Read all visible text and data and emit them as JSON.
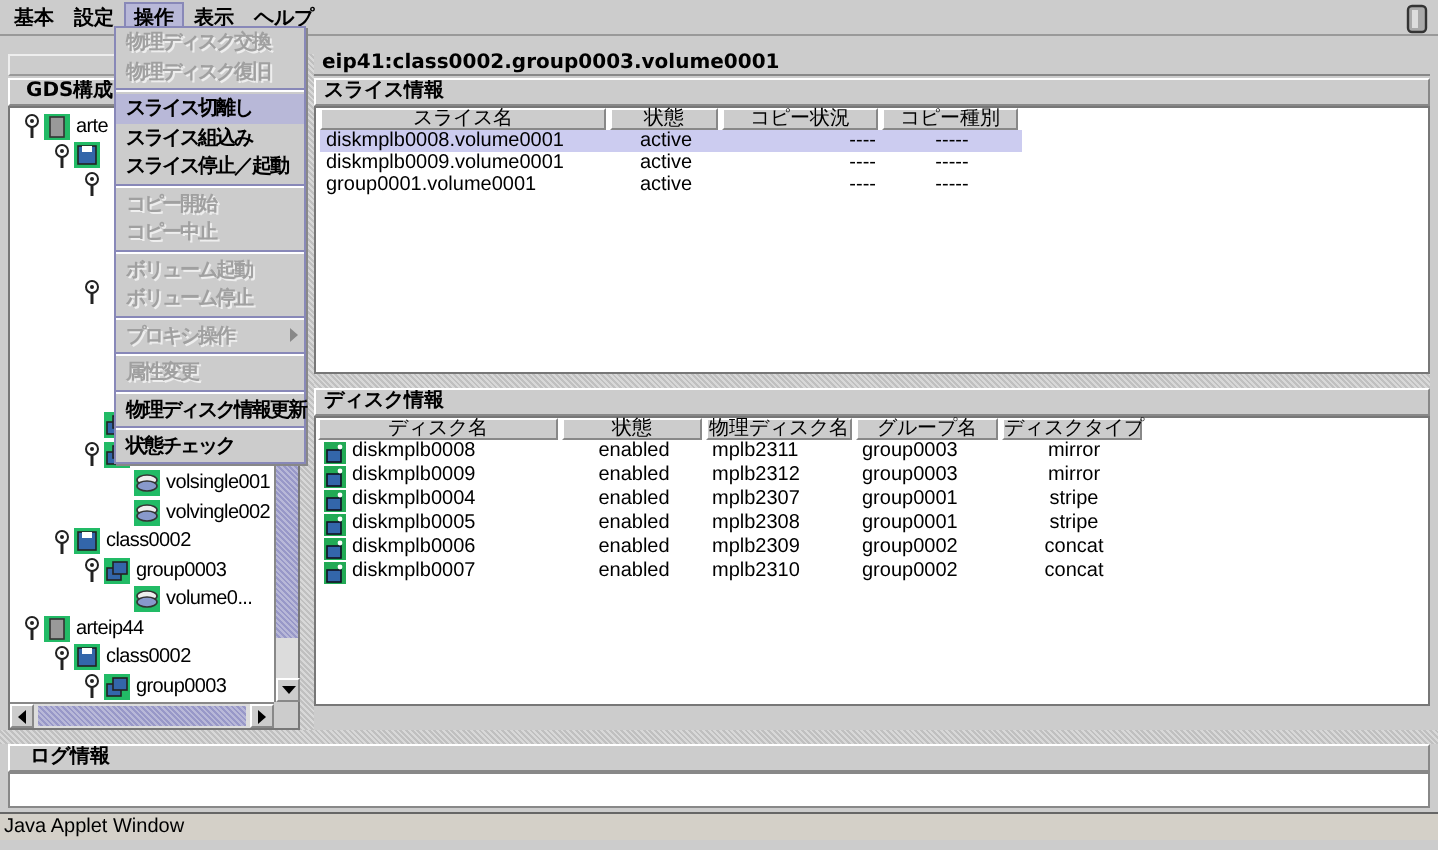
{
  "menu_bar": {
    "items": [
      {
        "label": "基本",
        "selected": false
      },
      {
        "label": "設定",
        "selected": false
      },
      {
        "label": "操作",
        "selected": true
      },
      {
        "label": "表示",
        "selected": false
      },
      {
        "label": "ヘルプ",
        "selected": false
      }
    ]
  },
  "open_menu": {
    "items": [
      {
        "kind": "item",
        "label": "物理ディスク交換",
        "disabled": true,
        "selected": false
      },
      {
        "kind": "item",
        "label": "物理ディスク復旧",
        "disabled": true,
        "selected": false
      },
      {
        "kind": "separator"
      },
      {
        "kind": "item",
        "label": "スライス切離し",
        "disabled": false,
        "selected": true
      },
      {
        "kind": "item",
        "label": "スライス組込み",
        "disabled": false,
        "selected": false
      },
      {
        "kind": "item",
        "label": "スライス停止／起動",
        "disabled": false,
        "selected": false
      },
      {
        "kind": "separator"
      },
      {
        "kind": "item",
        "label": "コピー開始",
        "disabled": true,
        "selected": false
      },
      {
        "kind": "item",
        "label": "コピー中止",
        "disabled": true,
        "selected": false
      },
      {
        "kind": "separator"
      },
      {
        "kind": "item",
        "label": "ボリューム起動",
        "disabled": true,
        "selected": false
      },
      {
        "kind": "item",
        "label": "ボリューム停止",
        "disabled": true,
        "selected": false
      },
      {
        "kind": "separator"
      },
      {
        "kind": "item",
        "label": "プロキシ操作",
        "disabled": true,
        "selected": false,
        "submenu": true
      },
      {
        "kind": "separator"
      },
      {
        "kind": "item",
        "label": "属性変更",
        "disabled": true,
        "selected": false
      },
      {
        "kind": "separator"
      },
      {
        "kind": "item",
        "label": "物理ディスク情報更新",
        "disabled": false,
        "selected": false
      },
      {
        "kind": "separator"
      },
      {
        "kind": "item",
        "label": "状態チェック",
        "disabled": false,
        "selected": false
      }
    ]
  },
  "tree_panel": {
    "title": "GDS構成",
    "tree": [
      {
        "kind": "node",
        "label": "arte",
        "expanded": true,
        "children": [
          {
            "kind": "class",
            "expanded": true,
            "children": [
              {
                "expanded": true
              },
              {
                "expanded": true
              },
              {
                "kind": "group"
              },
              {
                "kind": "group",
                "expanded": true,
                "children": [
                  {
                    "kind": "volume",
                    "label": "volsingle001"
                  },
                  {
                    "kind": "volume",
                    "label": "volvingle002"
                  }
                ]
              }
            ]
          },
          {
            "kind": "class",
            "label": "class0002",
            "expanded": true,
            "children": [
              {
                "kind": "group",
                "label": "group0003",
                "expanded": true,
                "children": [
                  {
                    "kind": "volume",
                    "label": "volume0..."
                  }
                ]
              }
            ]
          }
        ]
      },
      {
        "kind": "node",
        "label": "arteip44",
        "expanded": true,
        "children": [
          {
            "kind": "class",
            "label": "class0002",
            "expanded": true,
            "children": [
              {
                "kind": "group",
                "label": "group0003",
                "expanded": true
              }
            ]
          }
        ]
      }
    ]
  },
  "detail_panel": {
    "title": "eip41:class0002.group0003.volume0001",
    "slice_section": {
      "title": "スライス情報",
      "columns": [
        "スライス名",
        "状態",
        "コピー状況",
        "コピー種別"
      ],
      "rows": [
        {
          "cells": [
            "diskmplb0008.volume0001",
            "active",
            "----",
            "-----"
          ],
          "selected": true
        },
        {
          "cells": [
            "diskmplb0009.volume0001",
            "active",
            "----",
            "-----"
          ],
          "selected": false
        },
        {
          "cells": [
            "group0001.volume0001",
            "active",
            "----",
            "-----"
          ],
          "selected": false
        }
      ]
    },
    "disk_section": {
      "title": "ディスク情報",
      "columns": [
        "ディスク名",
        "状態",
        "物理ディスク名",
        "グループ名",
        "ディスクタイプ"
      ],
      "rows": [
        {
          "cells": [
            "diskmplb0008",
            "enabled",
            "mplb2311",
            "group0003",
            "mirror"
          ]
        },
        {
          "cells": [
            "diskmplb0009",
            "enabled",
            "mplb2312",
            "group0003",
            "mirror"
          ]
        },
        {
          "cells": [
            "diskmplb0004",
            "enabled",
            "mplb2307",
            "group0001",
            "stripe"
          ]
        },
        {
          "cells": [
            "diskmplb0005",
            "enabled",
            "mplb2308",
            "group0001",
            "stripe"
          ]
        },
        {
          "cells": [
            "diskmplb0006",
            "enabled",
            "mplb2309",
            "group0002",
            "concat"
          ]
        },
        {
          "cells": [
            "diskmplb0007",
            "enabled",
            "mplb2310",
            "group0002",
            "concat"
          ]
        }
      ]
    }
  },
  "log_panel": {
    "title": "ログ情報"
  },
  "status_bar": {
    "text": "Java Applet Window"
  }
}
